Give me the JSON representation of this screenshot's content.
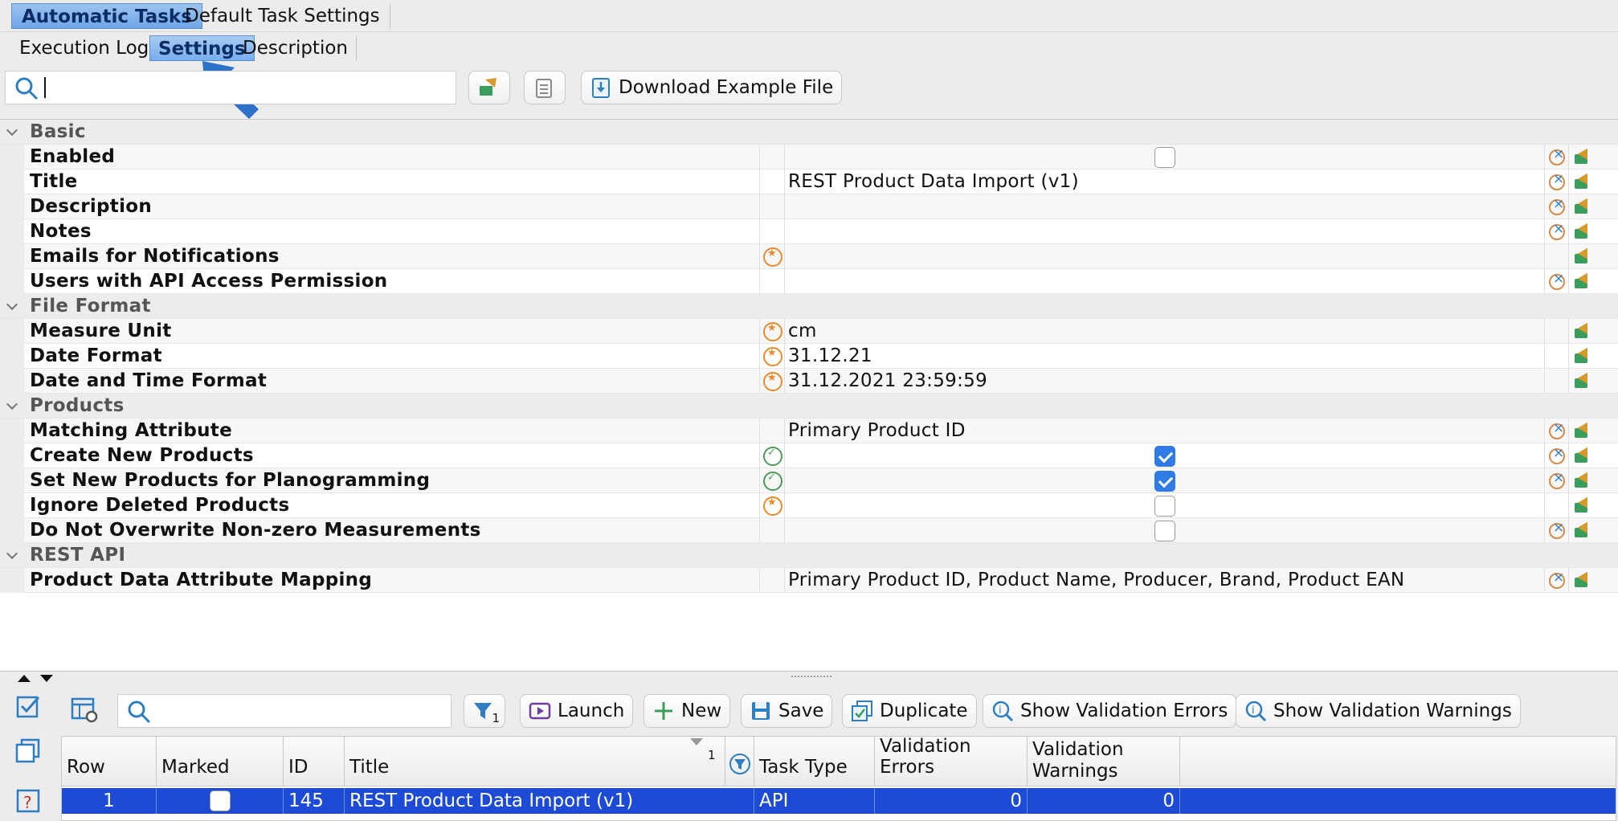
{
  "tabs_top": [
    "Automatic Tasks",
    "Default Task Settings"
  ],
  "tabs_sub": [
    "Execution Log",
    "Settings",
    "Description"
  ],
  "toolbar": {
    "download_label": "Download Example File"
  },
  "groups": {
    "basic": "Basic",
    "file_format": "File Format",
    "products": "Products",
    "rest_api": "REST API"
  },
  "props": {
    "enabled": {
      "label": "Enabled",
      "checked": false
    },
    "title": {
      "label": "Title",
      "value": "REST Product Data Import (v1)"
    },
    "description": {
      "label": "Description",
      "value": ""
    },
    "notes": {
      "label": "Notes",
      "value": ""
    },
    "emails": {
      "label": "Emails for Notifications",
      "value": ""
    },
    "users_api": {
      "label": "Users with API Access Permission",
      "value": ""
    },
    "measure_unit": {
      "label": "Measure Unit",
      "value": "cm"
    },
    "date_format": {
      "label": "Date Format",
      "value": "31.12.21"
    },
    "datetime_format": {
      "label": "Date and Time Format",
      "value": "31.12.2021 23:59:59"
    },
    "matching_attr": {
      "label": "Matching Attribute",
      "value": "Primary Product ID"
    },
    "create_new": {
      "label": "Create New Products",
      "checked": true
    },
    "set_planogram": {
      "label": "Set New Products for Planogramming",
      "checked": true
    },
    "ignore_deleted": {
      "label": "Ignore Deleted Products",
      "checked": false
    },
    "no_overwrite": {
      "label": "Do Not Overwrite Non-zero Measurements",
      "checked": false
    },
    "mapping": {
      "label": "Product Data Attribute Mapping",
      "value": "Primary Product ID, Product Name, Producer, Brand, Product EAN"
    }
  },
  "bottom_toolbar": {
    "filter_count": "1",
    "launch": "Launch",
    "new": "New",
    "save": "Save",
    "duplicate": "Duplicate",
    "show_errors": "Show Validation Errors",
    "show_warnings": "Show Validation Warnings"
  },
  "table": {
    "headers": {
      "row": "Row",
      "marked": "Marked",
      "id": "ID",
      "title": "Title",
      "sort_index": "1",
      "task_type": "Task Type",
      "validation_errors": "Validation Errors",
      "validation_warnings_1": "Validation",
      "validation_warnings_2": "Warnings"
    },
    "rows": [
      {
        "row": "1",
        "marked": false,
        "id": "145",
        "title": "REST Product Data Import (v1)",
        "task_type": "API",
        "validation_errors": "0",
        "validation_warnings": "0"
      }
    ]
  },
  "colors": {
    "selection": "#1d4bd6",
    "accent_tab": "#6da6e8",
    "inherit_orange": "#e9892c",
    "inherit_green": "#4d9a5a"
  }
}
